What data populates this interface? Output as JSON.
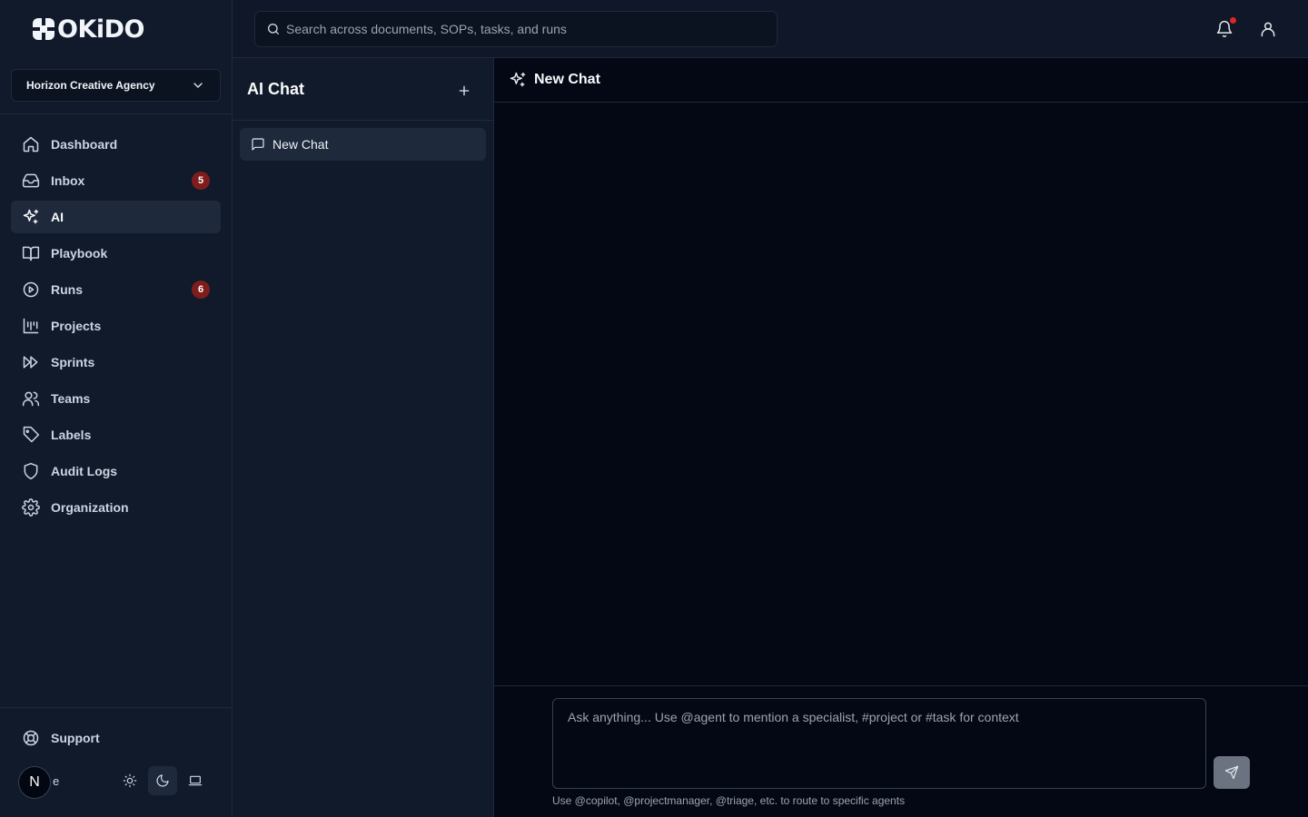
{
  "brand": {
    "name": "OKiDO"
  },
  "org": {
    "selected": "Horizon Creative Agency"
  },
  "nav": {
    "items": [
      {
        "label": "Dashboard",
        "icon": "home-icon"
      },
      {
        "label": "Inbox",
        "icon": "inbox-icon",
        "badge": "5"
      },
      {
        "label": "AI",
        "icon": "sparkles-icon",
        "active": true
      },
      {
        "label": "Playbook",
        "icon": "book-open-icon"
      },
      {
        "label": "Runs",
        "icon": "play-circle-icon",
        "badge": "6"
      },
      {
        "label": "Projects",
        "icon": "kanban-icon"
      },
      {
        "label": "Sprints",
        "icon": "fast-forward-icon"
      },
      {
        "label": "Teams",
        "icon": "users-icon"
      },
      {
        "label": "Labels",
        "icon": "tag-icon"
      },
      {
        "label": "Audit Logs",
        "icon": "shield-icon"
      },
      {
        "label": "Organization",
        "icon": "gear-icon"
      }
    ]
  },
  "footer": {
    "support_label": "Support",
    "avatar_initial": "N",
    "user_name_truncated": "e"
  },
  "search": {
    "placeholder": "Search across documents, SOPs, tasks, and runs"
  },
  "chatlist": {
    "title": "AI Chat",
    "items": [
      {
        "label": "New Chat"
      }
    ]
  },
  "main": {
    "title": "New Chat",
    "composer_placeholder": "Ask anything... Use @agent to mention a specialist, #project or #task for context",
    "hint": "Use @copilot, @projectmanager, @triage, etc. to route to specific agents"
  },
  "colors": {
    "background": "#0b1220",
    "sidebar": "#111a2b",
    "active_item": "#1e293b",
    "badge": "#7f1d1d",
    "notification_dot": "#dc2626"
  }
}
